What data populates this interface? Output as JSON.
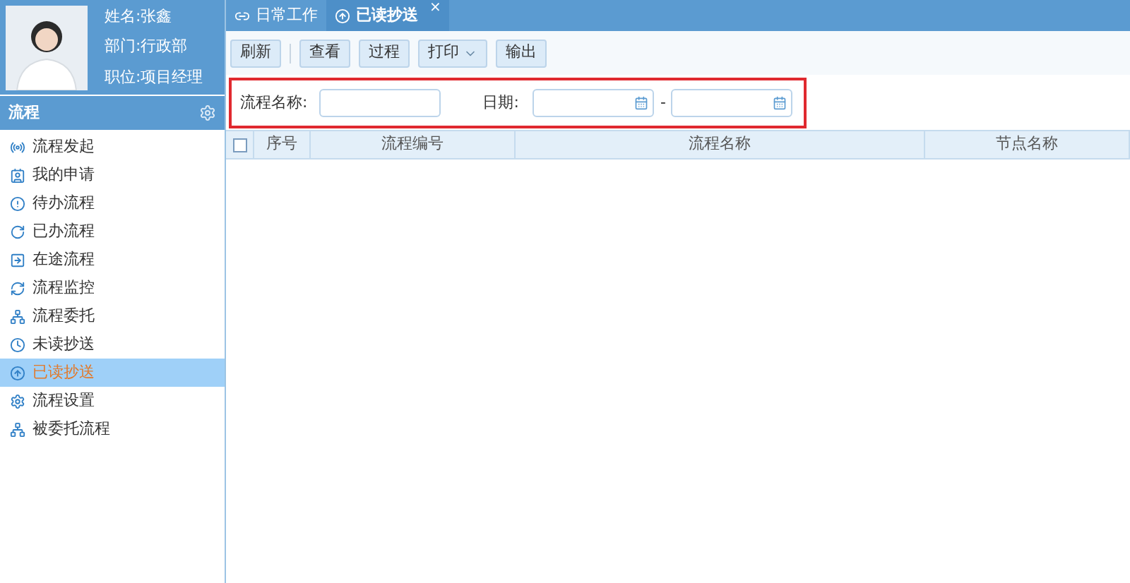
{
  "profile": {
    "name": "姓名:张鑫",
    "department": "部门:行政部",
    "position": "职位:项目经理"
  },
  "sidebar": {
    "title": "流程",
    "items": [
      {
        "label": "流程发起",
        "selected": false
      },
      {
        "label": "我的申请",
        "selected": false
      },
      {
        "label": "待办流程",
        "selected": false
      },
      {
        "label": "已办流程",
        "selected": false
      },
      {
        "label": "在途流程",
        "selected": false
      },
      {
        "label": "流程监控",
        "selected": false
      },
      {
        "label": "流程委托",
        "selected": false
      },
      {
        "label": "未读抄送",
        "selected": false
      },
      {
        "label": "已读抄送",
        "selected": true
      },
      {
        "label": "流程设置",
        "selected": false
      },
      {
        "label": "被委托流程",
        "selected": false
      }
    ]
  },
  "tabs": [
    {
      "label": "日常工作",
      "selected": false
    },
    {
      "label": "已读抄送",
      "selected": true,
      "close": "×"
    }
  ],
  "toolbar": [
    {
      "label": "刷新",
      "kind": "button"
    },
    {
      "kind": "separator"
    },
    {
      "label": "查看",
      "kind": "button"
    },
    {
      "label": "过程",
      "kind": "button"
    },
    {
      "label": "打印",
      "kind": "dropdown"
    },
    {
      "label": "输出",
      "kind": "button"
    }
  ],
  "search": {
    "name_label": "流程名称:",
    "date_label": "日期:",
    "date_separator": "-"
  },
  "table": {
    "columns": [
      "序号",
      "流程编号",
      "流程名称",
      "节点名称"
    ],
    "checked": false
  }
}
